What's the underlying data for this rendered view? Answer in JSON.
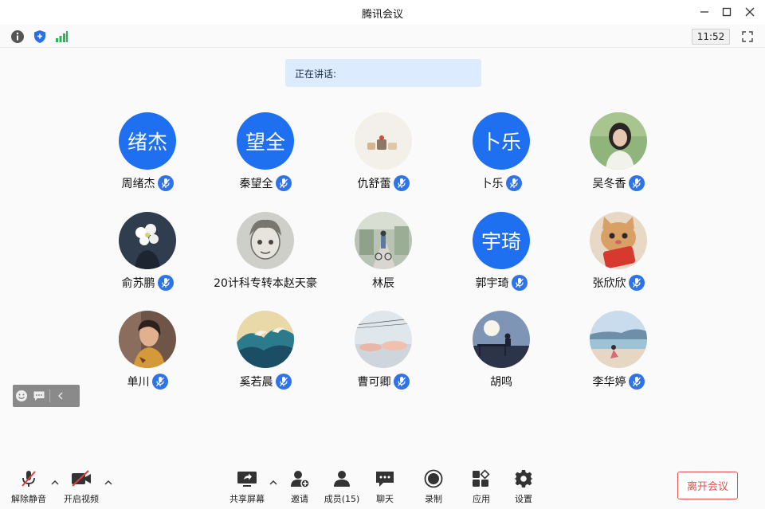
{
  "window": {
    "title": "腾讯会议"
  },
  "status": {
    "clock": "11:52"
  },
  "speaking": {
    "label": "正在讲话:"
  },
  "participants": [
    {
      "name": "周绪杰",
      "avatar_text": "绪杰",
      "avatar": "text",
      "mic": true
    },
    {
      "name": "秦望全",
      "avatar_text": "望全",
      "avatar": "text",
      "mic": true
    },
    {
      "name": "仇舒蕾",
      "avatar": "photo-cats",
      "mic": true
    },
    {
      "name": "卜乐",
      "avatar_text": "卜乐",
      "avatar": "text",
      "mic": true
    },
    {
      "name": "吴冬香",
      "avatar": "photo-girl",
      "mic": true
    },
    {
      "name": "俞苏鹏",
      "avatar": "photo-flowers",
      "mic": true
    },
    {
      "name": "20计科专转本赵天豪",
      "avatar": "photo-sketch",
      "mic": false
    },
    {
      "name": "林辰",
      "avatar": "photo-street",
      "mic": false
    },
    {
      "name": "郭宇琦",
      "avatar_text": "宇琦",
      "avatar": "text",
      "mic": true
    },
    {
      "name": "张欣欣",
      "avatar": "photo-cat",
      "mic": true
    },
    {
      "name": "单川",
      "avatar": "photo-portrait",
      "mic": true
    },
    {
      "name": "奚若晨",
      "avatar": "photo-wave",
      "mic": true
    },
    {
      "name": "曹可卿",
      "avatar": "photo-sky",
      "mic": true
    },
    {
      "name": "胡鸣",
      "avatar": "photo-sunset",
      "mic": false
    },
    {
      "name": "李华婷",
      "avatar": "photo-beach",
      "mic": true
    }
  ],
  "toolbar": {
    "unmute": "解除静音",
    "start_video": "开启视频",
    "share_screen": "共享屏幕",
    "invite": "邀请",
    "members": "成员(15)",
    "chat": "聊天",
    "record": "录制",
    "apps": "应用",
    "settings": "设置",
    "leave": "离开会议"
  },
  "colors": {
    "accent": "#1f6ff1",
    "leave": "#e34f4f",
    "speaking_bg": "#dcebfd"
  }
}
